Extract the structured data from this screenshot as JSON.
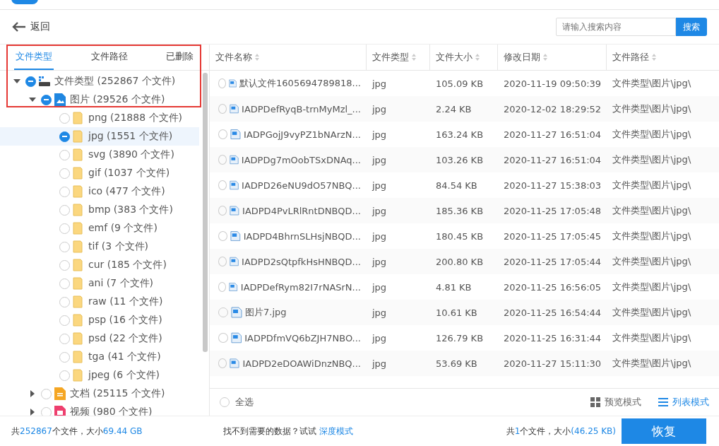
{
  "back": {
    "label": "返回"
  },
  "search": {
    "placeholder": "请输入搜索内容",
    "button": "搜索"
  },
  "tabs": [
    {
      "label": "文件类型",
      "selected": true
    },
    {
      "label": "文件路径",
      "selected": false
    },
    {
      "label": "已删除",
      "selected": false
    }
  ],
  "tree": [
    {
      "label": "文件类型 (252867 个文件)",
      "kind": "drive",
      "checked": true,
      "expanded": true,
      "selected": false,
      "children": [
        {
          "label": "图片 (29526 个文件)",
          "kind": "image",
          "checked": true,
          "expanded": true,
          "selected": false,
          "children": [
            {
              "label": "png (21888 个文件)",
              "kind": "folder",
              "checked": false,
              "selected": false
            },
            {
              "label": "jpg (1551 个文件)",
              "kind": "folder",
              "checked": true,
              "selected": true
            },
            {
              "label": "svg (3890 个文件)",
              "kind": "folder",
              "checked": false,
              "selected": false
            },
            {
              "label": "gif (1037 个文件)",
              "kind": "folder",
              "checked": false,
              "selected": false
            },
            {
              "label": "ico (477 个文件)",
              "kind": "folder",
              "checked": false,
              "selected": false
            },
            {
              "label": "bmp (383 个文件)",
              "kind": "folder",
              "checked": false,
              "selected": false
            },
            {
              "label": "emf (9 个文件)",
              "kind": "folder",
              "checked": false,
              "selected": false
            },
            {
              "label": "tif (3 个文件)",
              "kind": "folder",
              "checked": false,
              "selected": false
            },
            {
              "label": "cur (185 个文件)",
              "kind": "folder",
              "checked": false,
              "selected": false
            },
            {
              "label": "ani (7 个文件)",
              "kind": "folder",
              "checked": false,
              "selected": false
            },
            {
              "label": "raw (11 个文件)",
              "kind": "folder",
              "checked": false,
              "selected": false
            },
            {
              "label": "psp (16 个文件)",
              "kind": "folder",
              "checked": false,
              "selected": false
            },
            {
              "label": "psd (22 个文件)",
              "kind": "folder",
              "checked": false,
              "selected": false
            },
            {
              "label": "tga (41 个文件)",
              "kind": "folder",
              "checked": false,
              "selected": false
            },
            {
              "label": "jpeg (6 个文件)",
              "kind": "folder",
              "checked": false,
              "selected": false
            }
          ]
        },
        {
          "label": "文档 (25115 个文件)",
          "kind": "doc",
          "checked": false,
          "expanded": false,
          "selected": false
        },
        {
          "label": "视频 (980 个文件)",
          "kind": "video",
          "checked": false,
          "expanded": false,
          "selected": false
        }
      ]
    }
  ],
  "table": {
    "columns": [
      "文件名称",
      "文件类型",
      "文件大小",
      "修改日期",
      "文件路径"
    ],
    "rows": [
      {
        "checked": false,
        "cells": [
          "默认文件1605694789818...",
          "jpg",
          "105.09 KB",
          "2020-11-19 09:50:39",
          "文件类型\\图片\\jpg\\"
        ]
      },
      {
        "checked": false,
        "cells": [
          "IADPDefRyqB-trnMyMzl_...",
          "jpg",
          "2.24 KB",
          "2020-12-02 18:29:52",
          "文件类型\\图片\\jpg\\"
        ]
      },
      {
        "checked": false,
        "cells": [
          "IADPGojJ9vyPZ1bNArzN...",
          "jpg",
          "163.24 KB",
          "2020-11-27 16:51:04",
          "文件类型\\图片\\jpg\\"
        ]
      },
      {
        "checked": false,
        "cells": [
          "IADPDg7mOobTSxDNAq...",
          "jpg",
          "103.26 KB",
          "2020-11-27 16:51:04",
          "文件类型\\图片\\jpg\\"
        ]
      },
      {
        "checked": false,
        "cells": [
          "IADPD26eNU9dO57NBQ...",
          "jpg",
          "84.54 KB",
          "2020-11-27 15:38:03",
          "文件类型\\图片\\jpg\\"
        ]
      },
      {
        "checked": false,
        "cells": [
          "IADPD4PvLRlRntDNBQD...",
          "jpg",
          "185.36 KB",
          "2020-11-25 17:05:48",
          "文件类型\\图片\\jpg\\"
        ]
      },
      {
        "checked": false,
        "cells": [
          "IADPD4BhrnSLHsjNBQD...",
          "jpg",
          "180.45 KB",
          "2020-11-25 17:05:45",
          "文件类型\\图片\\jpg\\"
        ]
      },
      {
        "checked": false,
        "cells": [
          "IADPD2sQtpfkHsHNBQD...",
          "jpg",
          "200.80 KB",
          "2020-11-25 17:05:44",
          "文件类型\\图片\\jpg\\"
        ]
      },
      {
        "checked": false,
        "cells": [
          "IADPDefRym82I7rNASrN...",
          "jpg",
          "4.81 KB",
          "2020-11-25 16:56:05",
          "文件类型\\图片\\jpg\\"
        ]
      },
      {
        "checked": false,
        "cells": [
          "图片7.jpg",
          "jpg",
          "10.61 KB",
          "2020-11-25 16:54:44",
          "文件类型\\图片\\jpg\\"
        ]
      },
      {
        "checked": false,
        "cells": [
          "IADPDfmVQ6bZJH7NBO...",
          "jpg",
          "126.79 KB",
          "2020-11-25 16:31:44",
          "文件类型\\图片\\jpg\\"
        ]
      },
      {
        "checked": false,
        "cells": [
          "IADPD2eDOAWiDnzNBQ...",
          "jpg",
          "53.69 KB",
          "2020-11-27 15:11:30",
          "文件类型\\图片\\jpg\\"
        ]
      }
    ]
  },
  "select_all": {
    "label": "全选",
    "checked": false
  },
  "view_modes": [
    {
      "label": "预览模式",
      "kind": "grid",
      "selected": false
    },
    {
      "label": "列表模式",
      "kind": "list",
      "selected": true
    }
  ],
  "status": {
    "total_prefix": "共",
    "total_count": "252867",
    "total_mid": "个文件，大小",
    "total_size": "69.44 GB",
    "hint": "找不到需要的数据？试试",
    "hint_link": "深度模式",
    "sel_prefix": "共",
    "sel_count": "1",
    "sel_mid": "个文件，大小",
    "sel_size": "(46.25 KB)",
    "recover": "恢复"
  }
}
